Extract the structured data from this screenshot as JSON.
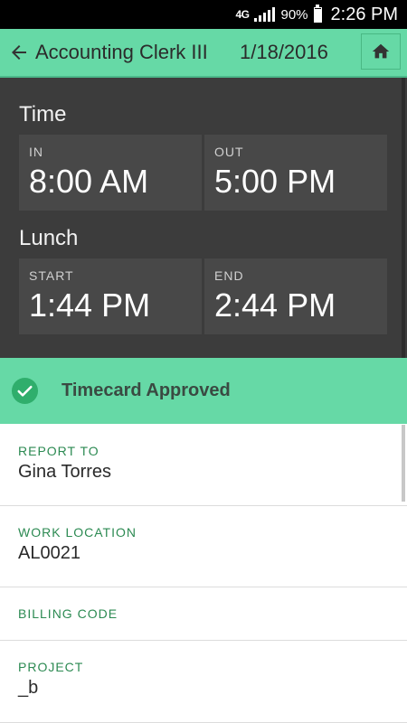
{
  "status_bar": {
    "network": "4G",
    "battery": "90%",
    "battery_level": 0.9,
    "time": "2:26 PM"
  },
  "app_bar": {
    "title": "Accounting Clerk III",
    "date": "1/18/2016",
    "back_icon": "arrow-left-icon",
    "home_icon": "home-icon"
  },
  "time_section": {
    "title": "Time",
    "in_label": "IN",
    "in_value": "8:00 AM",
    "out_label": "OUT",
    "out_value": "5:00 PM"
  },
  "lunch_section": {
    "title": "Lunch",
    "start_label": "START",
    "start_value": "1:44 PM",
    "end_label": "END",
    "end_value": "2:44 PM"
  },
  "banner": {
    "text": "Timecard Approved",
    "icon": "check-circle-icon"
  },
  "fields": {
    "report_to": {
      "label": "REPORT TO",
      "value": "Gina Torres"
    },
    "work_location": {
      "label": "WORK LOCATION",
      "value": "AL0021"
    },
    "billing_code": {
      "label": "BILLING CODE",
      "value": ""
    },
    "project": {
      "label": "PROJECT",
      "value": "_b"
    }
  },
  "colors": {
    "accent_green": "#66d9a6",
    "label_green": "#2c8a52",
    "panel_dark": "#3c3c3c",
    "tile_dark": "#484848"
  }
}
